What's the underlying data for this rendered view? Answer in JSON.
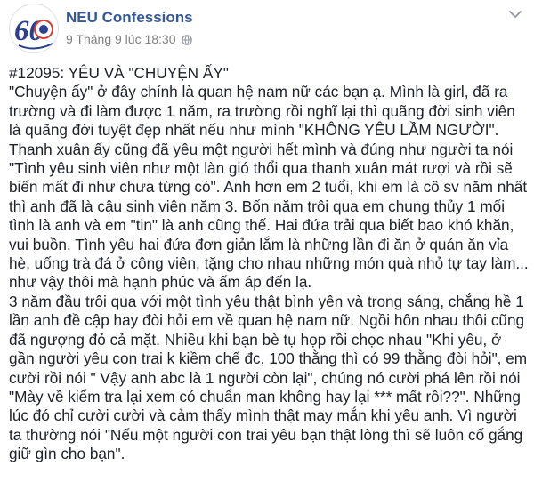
{
  "post": {
    "page_name": "NEU Confessions",
    "timestamp": "9 Tháng 9 lúc 18:30",
    "avatar_text": "60",
    "lines": [
      "#12095: YÊU VÀ \"CHUYỆN ẤY\"",
      "\"Chuyện ấy\" ở đây chính là quan hệ nam nữ các bạn ạ. Mình là girl, đã ra",
      "trường và đi làm được 1 năm, ra trường rồi nghĩ lại thì quãng đời sinh viên",
      "là quãng đời tuyệt đẹp nhất nếu như mình \"KHÔNG YÊU LẦM NGƯỜI\".",
      "Thanh xuân ấy cũng đã yêu một người hết mình và đúng như người ta nói",
      "\"Tình yêu sinh viên như một làn gió thổi qua thanh xuân mát rượi và rồi sẽ",
      "biến mất đi như chưa từng có\". Anh hơn em 2 tuổi, khi em là cô sv năm nhất",
      "thì anh đã là cậu sinh viên năm 3. Bốn năm trôi qua em chung thủy 1 mối",
      "tình là anh và em \"tin\" là anh cũng thế. Hai đứa trải qua biết bao khó khăn,",
      "vui buồn. Tình yêu hai đứa đơn giản lắm là những lần đi ăn ở quán ăn vỉa",
      "hè, uống trà đá ở công viên, tặng cho nhau những món quà nhỏ tự tay làm...",
      "như vậy thôi mà hạnh phúc và ấm áp đến lạ.",
      "3 năm đầu trôi qua với một tình yêu thật bình yên và trong sáng, chẳng hề 1",
      "lần anh đề cập hay đòi hỏi em về quan hệ nam nữ. Ngồi hôn nhau thôi cũng",
      "đã ngượng đỏ cả mặt. Nhiều khi bạn bè tụ họp rồi chọc nhau \"Khi yêu, ở",
      "gần người yêu con trai k kiềm chế đc, 100 thằng thì có 99 thằng đòi hỏi\", em",
      "cười rồi nói \" Vậy anh abc là 1 người còn lại\", chúng nó cười phá lên rồi nói",
      "\"Mày về kiểm tra lại xem có chuẩn man không hay lại *** mất rồi??\". Những",
      "lúc đó chỉ cười cười và cảm thấy mình thật may mắn khi yêu anh. Vì người",
      "ta thường nói \"Nếu một người con trai yêu bạn thật lòng thì sẽ luôn cố gắng",
      "giữ gìn cho bạn\"."
    ]
  },
  "icons": {
    "avatar": "neu-60-anniversary-logo",
    "privacy": "globe-icon",
    "options": "chevron-down-icon"
  },
  "colors": {
    "page_name": "#365899",
    "text": "#1d2129",
    "meta": "#7f7f7f",
    "logo_blue": "#2b3f8f",
    "logo_red": "#d93a2b"
  }
}
